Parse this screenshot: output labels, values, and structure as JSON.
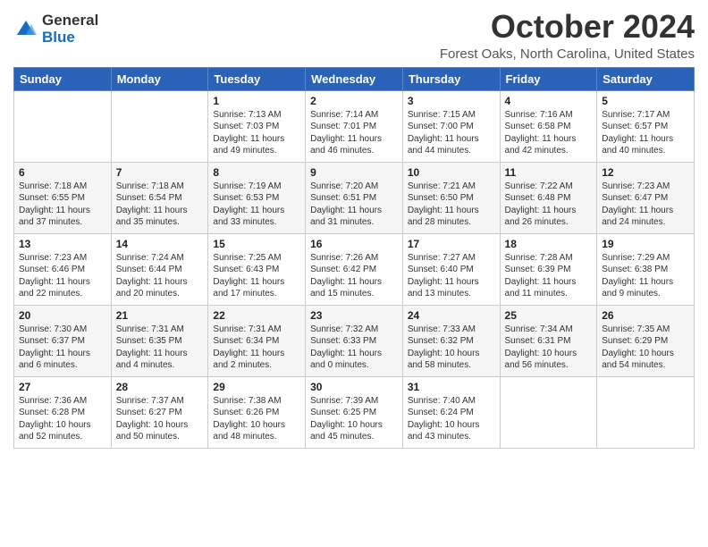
{
  "logo": {
    "general": "General",
    "blue": "Blue"
  },
  "header": {
    "month": "October 2024",
    "location": "Forest Oaks, North Carolina, United States"
  },
  "weekdays": [
    "Sunday",
    "Monday",
    "Tuesday",
    "Wednesday",
    "Thursday",
    "Friday",
    "Saturday"
  ],
  "weeks": [
    [
      {
        "day": "",
        "info": ""
      },
      {
        "day": "",
        "info": ""
      },
      {
        "day": "1",
        "info": "Sunrise: 7:13 AM\nSunset: 7:03 PM\nDaylight: 11 hours and 49 minutes."
      },
      {
        "day": "2",
        "info": "Sunrise: 7:14 AM\nSunset: 7:01 PM\nDaylight: 11 hours and 46 minutes."
      },
      {
        "day": "3",
        "info": "Sunrise: 7:15 AM\nSunset: 7:00 PM\nDaylight: 11 hours and 44 minutes."
      },
      {
        "day": "4",
        "info": "Sunrise: 7:16 AM\nSunset: 6:58 PM\nDaylight: 11 hours and 42 minutes."
      },
      {
        "day": "5",
        "info": "Sunrise: 7:17 AM\nSunset: 6:57 PM\nDaylight: 11 hours and 40 minutes."
      }
    ],
    [
      {
        "day": "6",
        "info": "Sunrise: 7:18 AM\nSunset: 6:55 PM\nDaylight: 11 hours and 37 minutes."
      },
      {
        "day": "7",
        "info": "Sunrise: 7:18 AM\nSunset: 6:54 PM\nDaylight: 11 hours and 35 minutes."
      },
      {
        "day": "8",
        "info": "Sunrise: 7:19 AM\nSunset: 6:53 PM\nDaylight: 11 hours and 33 minutes."
      },
      {
        "day": "9",
        "info": "Sunrise: 7:20 AM\nSunset: 6:51 PM\nDaylight: 11 hours and 31 minutes."
      },
      {
        "day": "10",
        "info": "Sunrise: 7:21 AM\nSunset: 6:50 PM\nDaylight: 11 hours and 28 minutes."
      },
      {
        "day": "11",
        "info": "Sunrise: 7:22 AM\nSunset: 6:48 PM\nDaylight: 11 hours and 26 minutes."
      },
      {
        "day": "12",
        "info": "Sunrise: 7:23 AM\nSunset: 6:47 PM\nDaylight: 11 hours and 24 minutes."
      }
    ],
    [
      {
        "day": "13",
        "info": "Sunrise: 7:23 AM\nSunset: 6:46 PM\nDaylight: 11 hours and 22 minutes."
      },
      {
        "day": "14",
        "info": "Sunrise: 7:24 AM\nSunset: 6:44 PM\nDaylight: 11 hours and 20 minutes."
      },
      {
        "day": "15",
        "info": "Sunrise: 7:25 AM\nSunset: 6:43 PM\nDaylight: 11 hours and 17 minutes."
      },
      {
        "day": "16",
        "info": "Sunrise: 7:26 AM\nSunset: 6:42 PM\nDaylight: 11 hours and 15 minutes."
      },
      {
        "day": "17",
        "info": "Sunrise: 7:27 AM\nSunset: 6:40 PM\nDaylight: 11 hours and 13 minutes."
      },
      {
        "day": "18",
        "info": "Sunrise: 7:28 AM\nSunset: 6:39 PM\nDaylight: 11 hours and 11 minutes."
      },
      {
        "day": "19",
        "info": "Sunrise: 7:29 AM\nSunset: 6:38 PM\nDaylight: 11 hours and 9 minutes."
      }
    ],
    [
      {
        "day": "20",
        "info": "Sunrise: 7:30 AM\nSunset: 6:37 PM\nDaylight: 11 hours and 6 minutes."
      },
      {
        "day": "21",
        "info": "Sunrise: 7:31 AM\nSunset: 6:35 PM\nDaylight: 11 hours and 4 minutes."
      },
      {
        "day": "22",
        "info": "Sunrise: 7:31 AM\nSunset: 6:34 PM\nDaylight: 11 hours and 2 minutes."
      },
      {
        "day": "23",
        "info": "Sunrise: 7:32 AM\nSunset: 6:33 PM\nDaylight: 11 hours and 0 minutes."
      },
      {
        "day": "24",
        "info": "Sunrise: 7:33 AM\nSunset: 6:32 PM\nDaylight: 10 hours and 58 minutes."
      },
      {
        "day": "25",
        "info": "Sunrise: 7:34 AM\nSunset: 6:31 PM\nDaylight: 10 hours and 56 minutes."
      },
      {
        "day": "26",
        "info": "Sunrise: 7:35 AM\nSunset: 6:29 PM\nDaylight: 10 hours and 54 minutes."
      }
    ],
    [
      {
        "day": "27",
        "info": "Sunrise: 7:36 AM\nSunset: 6:28 PM\nDaylight: 10 hours and 52 minutes."
      },
      {
        "day": "28",
        "info": "Sunrise: 7:37 AM\nSunset: 6:27 PM\nDaylight: 10 hours and 50 minutes."
      },
      {
        "day": "29",
        "info": "Sunrise: 7:38 AM\nSunset: 6:26 PM\nDaylight: 10 hours and 48 minutes."
      },
      {
        "day": "30",
        "info": "Sunrise: 7:39 AM\nSunset: 6:25 PM\nDaylight: 10 hours and 45 minutes."
      },
      {
        "day": "31",
        "info": "Sunrise: 7:40 AM\nSunset: 6:24 PM\nDaylight: 10 hours and 43 minutes."
      },
      {
        "day": "",
        "info": ""
      },
      {
        "day": "",
        "info": ""
      }
    ]
  ]
}
